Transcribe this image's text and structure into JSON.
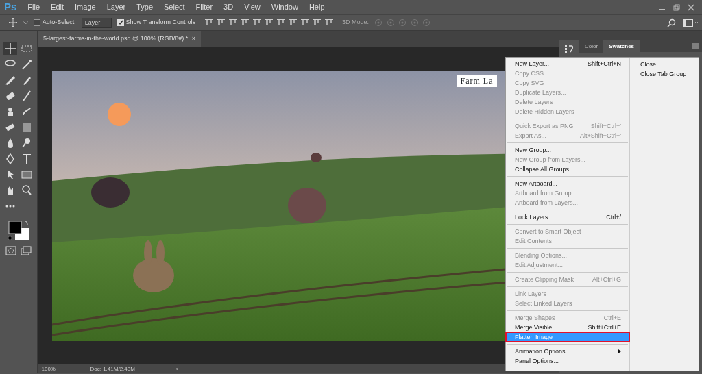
{
  "app": {
    "logo": "Ps"
  },
  "menubar": [
    "File",
    "Edit",
    "Image",
    "Layer",
    "Type",
    "Select",
    "Filter",
    "3D",
    "View",
    "Window",
    "Help"
  ],
  "options_bar": {
    "auto_select": {
      "label": "Auto-Select:",
      "checked": false
    },
    "target": "Layer",
    "transform": {
      "label": "Show Transform Controls",
      "checked": true
    },
    "mode_label": "3D Mode:"
  },
  "document_tab": {
    "title": "5-largest-farms-in-the-world.psd @ 100% (RGB/8#) *",
    "close": "×"
  },
  "canvas": {
    "text_layer": "Farm La"
  },
  "panel_tabs": [
    {
      "label": "Color",
      "selected": false
    },
    {
      "label": "Swatches",
      "selected": true
    }
  ],
  "context_menu": {
    "groups": [
      [
        {
          "label": "New Layer...",
          "shortcut": "Shift+Ctrl+N",
          "disabled": false,
          "selected": false
        },
        {
          "label": "Copy CSS",
          "disabled": true,
          "selected": false
        },
        {
          "label": "Copy SVG",
          "disabled": true,
          "selected": false
        },
        {
          "label": "Duplicate Layers...",
          "disabled": true,
          "selected": false
        },
        {
          "label": "Delete Layers",
          "disabled": true,
          "selected": false
        },
        {
          "label": "Delete Hidden Layers",
          "disabled": true,
          "selected": false
        }
      ],
      [
        {
          "label": "Quick Export as PNG",
          "shortcut": "Shift+Ctrl+'",
          "disabled": true,
          "selected": false
        },
        {
          "label": "Export As...",
          "shortcut": "Alt+Shift+Ctrl+'",
          "disabled": true,
          "selected": false
        }
      ],
      [
        {
          "label": "New Group...",
          "disabled": false,
          "selected": false
        },
        {
          "label": "New Group from Layers...",
          "disabled": true,
          "selected": false
        },
        {
          "label": "Collapse All Groups",
          "disabled": false,
          "selected": false
        }
      ],
      [
        {
          "label": "New Artboard...",
          "disabled": false,
          "selected": false
        },
        {
          "label": "Artboard from Group...",
          "disabled": true,
          "selected": false
        },
        {
          "label": "Artboard from Layers...",
          "disabled": true,
          "selected": false
        }
      ],
      [
        {
          "label": "Lock Layers...",
          "shortcut": "Ctrl+/",
          "disabled": false,
          "selected": false
        }
      ],
      [
        {
          "label": "Convert to Smart Object",
          "disabled": true,
          "selected": false
        },
        {
          "label": "Edit Contents",
          "disabled": true,
          "selected": false
        }
      ],
      [
        {
          "label": "Blending Options...",
          "disabled": true,
          "selected": false
        },
        {
          "label": "Edit Adjustment...",
          "disabled": true,
          "selected": false
        }
      ],
      [
        {
          "label": "Create Clipping Mask",
          "shortcut": "Alt+Ctrl+G",
          "disabled": true,
          "selected": false
        }
      ],
      [
        {
          "label": "Link Layers",
          "disabled": true,
          "selected": false
        },
        {
          "label": "Select Linked Layers",
          "disabled": true,
          "selected": false
        }
      ],
      [
        {
          "label": "Merge Shapes",
          "shortcut": "Ctrl+E",
          "disabled": true,
          "selected": false
        },
        {
          "label": "Merge Visible",
          "shortcut": "Shift+Ctrl+E",
          "disabled": false,
          "selected": false
        },
        {
          "label": "Flatten Image",
          "disabled": false,
          "selected": true
        }
      ],
      [
        {
          "label": "Animation Options",
          "disabled": false,
          "selected": false,
          "submenu": true
        },
        {
          "label": "Panel Options...",
          "disabled": false,
          "selected": false
        }
      ]
    ],
    "side_items": [
      "Close",
      "Close Tab Group"
    ]
  },
  "status_bar": {
    "zoom": "100%",
    "doc": "Doc: 1.41M/2.43M",
    "arrow": "›"
  }
}
